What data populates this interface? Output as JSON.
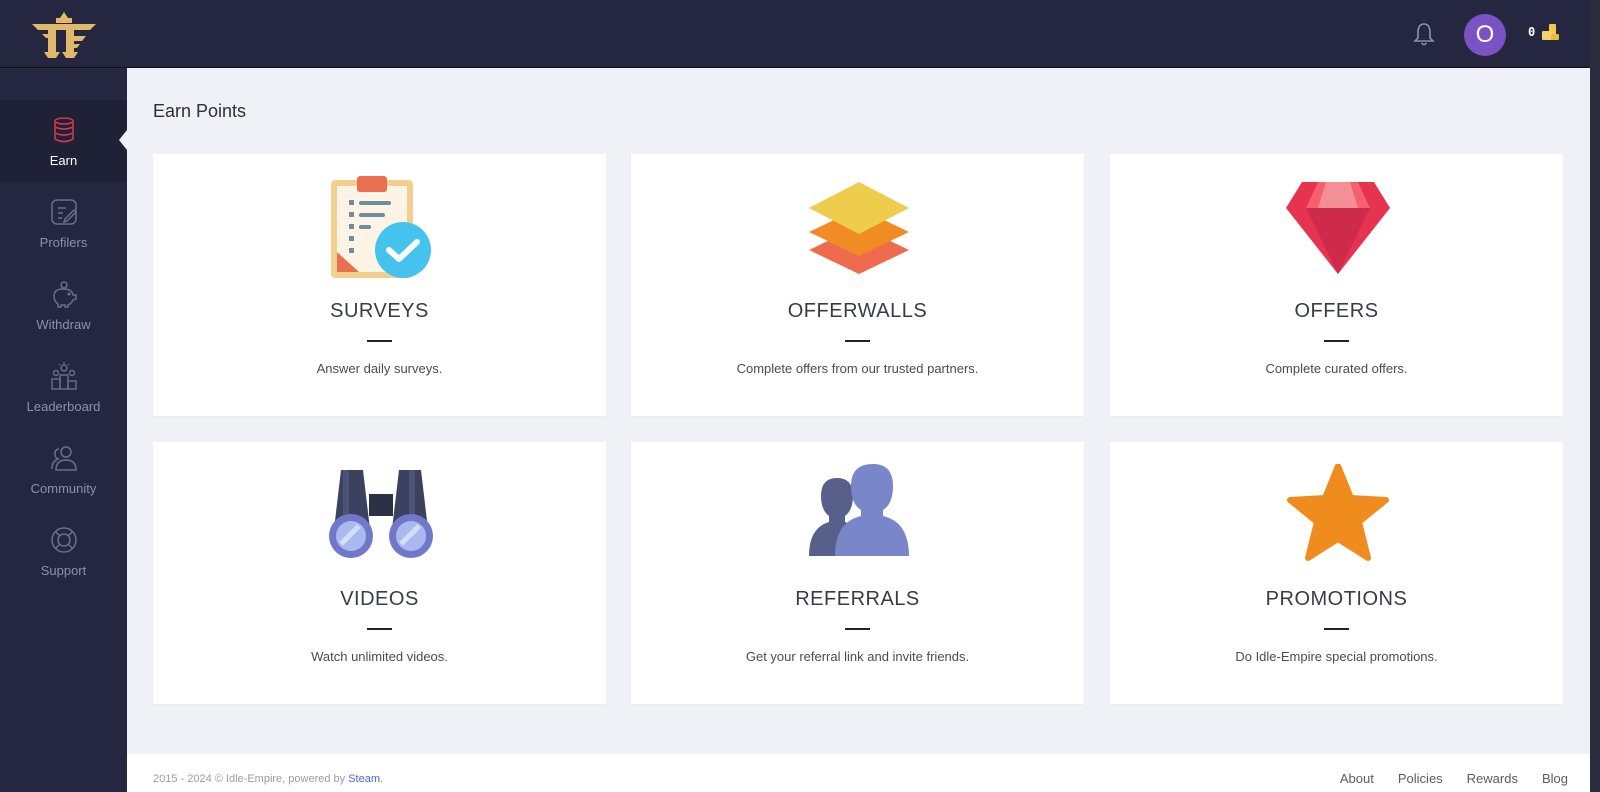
{
  "header": {
    "avatar_initial": "O",
    "balance": "0",
    "icons": {
      "notifications": "bell-icon",
      "coins": "coins-icon",
      "logo": "eagle-logo"
    }
  },
  "sidebar": {
    "items": [
      {
        "label": "Earn",
        "icon": "coins-stack-icon",
        "active": true
      },
      {
        "label": "Profilers",
        "icon": "profile-edit-icon",
        "active": false
      },
      {
        "label": "Withdraw",
        "icon": "piggy-bank-icon",
        "active": false
      },
      {
        "label": "Leaderboard",
        "icon": "trophy-podium-icon",
        "active": false
      },
      {
        "label": "Community",
        "icon": "users-icon",
        "active": false
      },
      {
        "label": "Support",
        "icon": "lifebuoy-icon",
        "active": false
      }
    ]
  },
  "main": {
    "title": "Earn Points",
    "cards": [
      {
        "title": "SURVEYS",
        "desc": "Answer daily surveys.",
        "icon": "clipboard-check-icon"
      },
      {
        "title": "OFFERWALLS",
        "desc": "Complete offers from our trusted partners.",
        "icon": "layers-icon"
      },
      {
        "title": "OFFERS",
        "desc": "Complete curated offers.",
        "icon": "gem-icon"
      },
      {
        "title": "VIDEOS",
        "desc": "Watch unlimited videos.",
        "icon": "binoculars-icon"
      },
      {
        "title": "REFERRALS",
        "desc": "Get your referral link and invite friends.",
        "icon": "people-icon"
      },
      {
        "title": "PROMOTIONS",
        "desc": "Do Idle-Empire special promotions.",
        "icon": "star-icon"
      }
    ]
  },
  "footer": {
    "copyright_prefix": "2015 - 2024 © Idle-Empire, powered by ",
    "copyright_link": "Steam",
    "copyright_suffix": ".",
    "links": [
      "About",
      "Policies",
      "Rewards",
      "Blog"
    ]
  },
  "colors": {
    "topbar": "#252740",
    "sidebar": "#252740",
    "background": "#f0f1f6",
    "avatar": "#7a52c4",
    "accent_link": "#4b6bd3"
  }
}
